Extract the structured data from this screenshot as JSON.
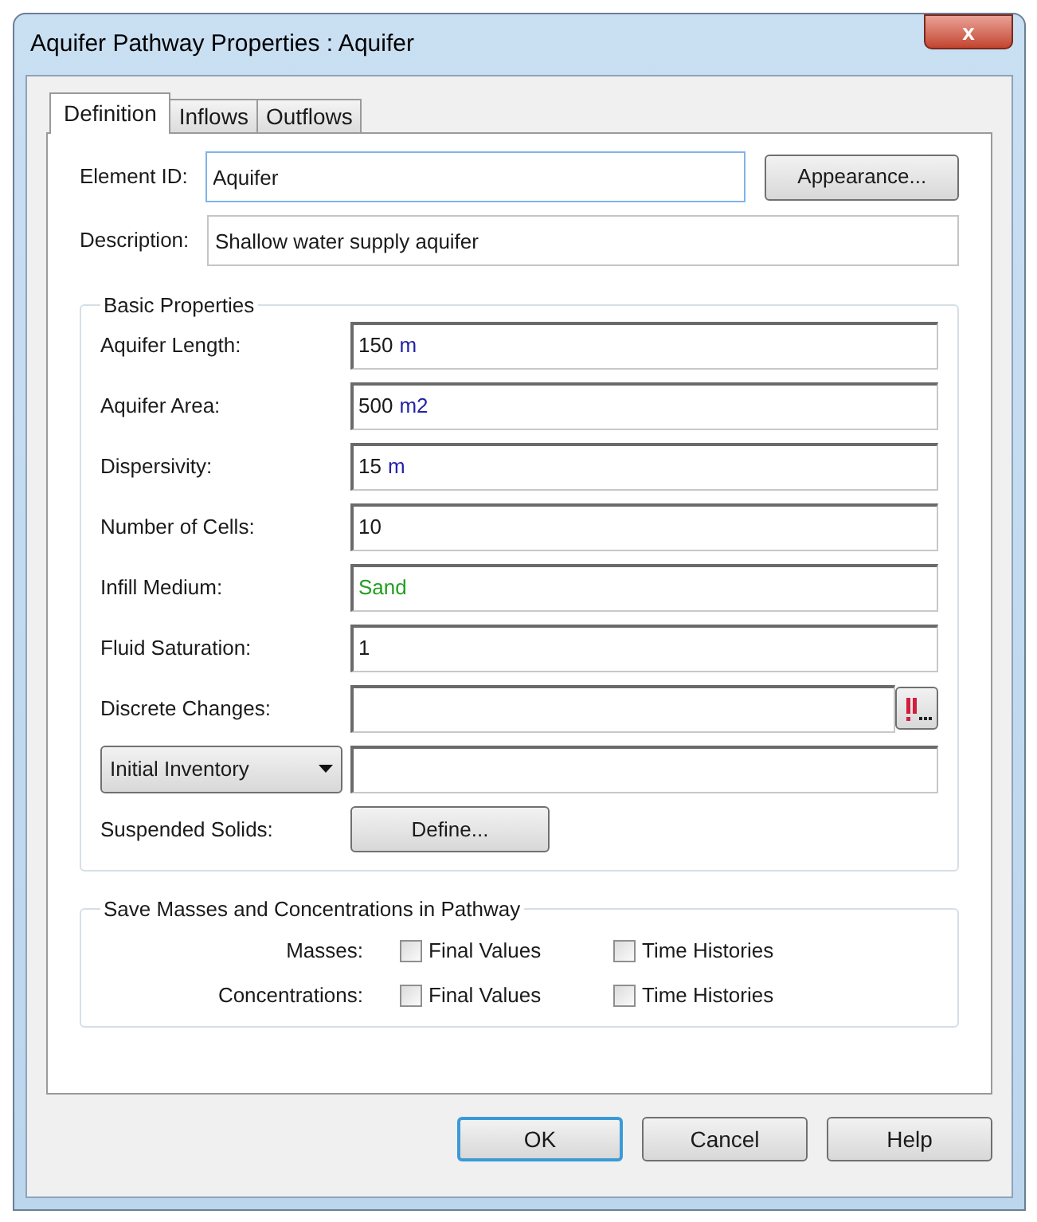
{
  "window": {
    "title": "Aquifer Pathway Properties : Aquifer",
    "close": "x"
  },
  "tabs": [
    {
      "label": "Definition",
      "selected": true
    },
    {
      "label": "Inflows",
      "selected": false
    },
    {
      "label": "Outflows",
      "selected": false
    }
  ],
  "element_id": {
    "label": "Element ID:",
    "value": "Aquifer",
    "button": "Appearance..."
  },
  "description": {
    "label": "Description:",
    "value": "Shallow water supply aquifer"
  },
  "basic_properties": {
    "title": "Basic Properties",
    "rows": [
      {
        "kind": "field",
        "label": "Aquifer Length:",
        "value": "150",
        "unit": "m"
      },
      {
        "kind": "field",
        "label": "Aquifer Area:",
        "value": "500",
        "unit": "m2"
      },
      {
        "kind": "field",
        "label": "Dispersivity:",
        "value": "15",
        "unit": "m"
      },
      {
        "kind": "field",
        "label": "Number of Cells:",
        "value": "10"
      },
      {
        "kind": "field",
        "label": "Infill Medium:",
        "value": "Sand",
        "color": "#22a022"
      },
      {
        "kind": "field",
        "label": "Fluid Saturation:",
        "value": "1"
      },
      {
        "kind": "picker",
        "label": "Discrete Changes:",
        "value": ""
      },
      {
        "kind": "dropdown",
        "label": "Initial Inventory",
        "value": ""
      },
      {
        "kind": "button",
        "label": "Suspended Solids:",
        "button": "Define..."
      }
    ]
  },
  "save_section": {
    "title": "Save Masses and Concentrations in Pathway",
    "rows": [
      {
        "label": "Masses:",
        "options": [
          {
            "label": "Final Values",
            "checked": false
          },
          {
            "label": "Time Histories",
            "checked": false
          }
        ]
      },
      {
        "label": "Concentrations:",
        "options": [
          {
            "label": "Final Values",
            "checked": false
          },
          {
            "label": "Time Histories",
            "checked": false
          }
        ]
      }
    ]
  },
  "buttons": [
    {
      "label": "OK",
      "default": true
    },
    {
      "label": "Cancel",
      "default": false
    },
    {
      "label": "Help",
      "default": false
    }
  ]
}
